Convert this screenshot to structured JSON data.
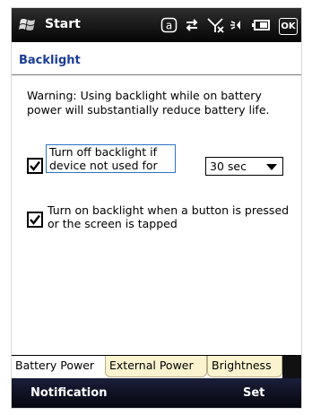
{
  "statusbar": {
    "start_label": "Start",
    "icons": [
      "at-sign-icon",
      "sync-arrows-icon",
      "no-signal-icon",
      "volume-icon",
      "battery-icon"
    ],
    "ok_label": "OK"
  },
  "page": {
    "title": "Backlight",
    "warning": "Warning: Using backlight while on battery power will substantially reduce battery life."
  },
  "options": {
    "turn_off": {
      "label": "Turn off backlight if device not used for",
      "checked": true
    },
    "timeout": {
      "selected": "30 sec"
    },
    "turn_on": {
      "label": "Turn on backlight when a button is pressed or the screen is tapped",
      "checked": true
    }
  },
  "tabs": [
    {
      "label": "Battery Power",
      "active": true
    },
    {
      "label": "External Power",
      "active": false
    },
    {
      "label": "Brightness",
      "active": false
    }
  ],
  "softkeys": {
    "left": "Notification",
    "right": "Set"
  },
  "colors": {
    "title": "#1a3c96",
    "tab_inactive_bg": "#fbf3cf",
    "statusbar_bg": "#1a1a1a",
    "softkey_bg": "#10132a",
    "focus_border": "#2c73c8"
  }
}
